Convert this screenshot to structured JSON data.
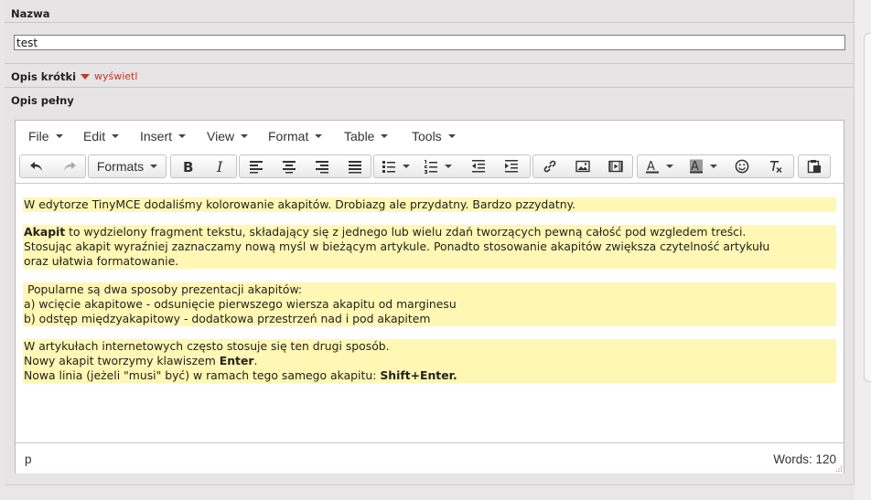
{
  "fields": {
    "name_label": "Nazwa",
    "name_value": "test",
    "short_desc_label": "Opis krótki",
    "short_desc_toggle": "wyświetl",
    "full_desc_label": "Opis pełny"
  },
  "menubar": {
    "file": "File",
    "edit": "Edit",
    "insert": "Insert",
    "view": "View",
    "format": "Format",
    "table": "Table",
    "tools": "Tools"
  },
  "toolbar": {
    "formats_label": "Formats",
    "icons": [
      "undo-icon",
      "redo-icon",
      "bold-icon",
      "italic-icon",
      "align-left-icon",
      "align-center-icon",
      "align-right-icon",
      "align-justify-icon",
      "bullet-list-icon",
      "numbered-list-icon",
      "outdent-icon",
      "indent-icon",
      "link-icon",
      "image-icon",
      "media-icon",
      "text-color-icon",
      "background-color-icon",
      "emoticons-icon",
      "clear-formatting-icon",
      "paste-icon"
    ]
  },
  "content": {
    "p1": "W edytorze TinyMCE dodaliśmy kolorowanie akapitów. Drobiazg ale przydatny. Bardzo pzzydatny.",
    "p2_bold": "Akapit",
    "p2_line1_rest": " to wydzielony fragment tekstu, składający się z jednego lub wielu zdań tworzących pewną całość pod wzgledem treści.",
    "p2_line2": "Stosując akapit wyraźniej zaznaczamy nową myśl w bieżącym artykule. Ponadto stosowanie akapitów zwiększa czytelność artykułu",
    "p2_line3": "oraz ułatwia formatowanie.",
    "p3_line1": " Popularne są dwa sposoby prezentacji akapitów:",
    "p3_line2": "a) wcięcie akapitowe - odsunięcie pierwszego wiersza akapitu od marginesu",
    "p3_line3": "b) odstęp międzyakapitowy - dodatkowa przestrzeń nad i pod akapitem",
    "p4_line1": "W artykułach internetowych często stosuje się ten drugi sposób.",
    "p4_line2_pre": "Nowy akapit tworzymy klawiszem ",
    "p4_line2_bold": "Enter",
    "p4_line2_post": ".",
    "p4_line3_pre": "Nowa linia (jeżeli \"musi\" być) w ramach tego samego akapitu: ",
    "p4_line3_bold": "Shift+Enter."
  },
  "statusbar": {
    "path": "p",
    "word_count": "Words: 120"
  },
  "colors": {
    "paragraph_highlight": "#fff7b3",
    "toggle_link": "#c0392b",
    "page_background": "#e8e6e6"
  }
}
